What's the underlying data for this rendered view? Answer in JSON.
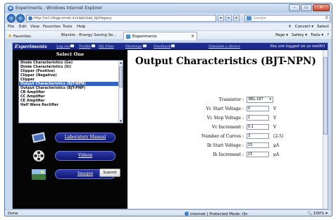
{
  "window": {
    "title": "Experiments - Windows Internet Explorer",
    "buttons": {
      "minimize": "–",
      "maximize": "▭",
      "close": "✕"
    }
  },
  "address_bar": {
    "url": "http://vcl.iitkgp.ernet.in/vlab/vlab_bjt/legacy",
    "search_placeholder": "Google",
    "tools": [
      "▾",
      "✕",
      "⟳"
    ]
  },
  "menu": {
    "items": [
      "File",
      "Edit",
      "View",
      "Favorites",
      "Tools",
      "Help"
    ],
    "right": [
      "✕",
      "Convert ▾",
      "Select"
    ]
  },
  "favorites_bar": {
    "favorites_label": "Favorites",
    "items": [
      "Blackle - Energy Saving Se..."
    ],
    "active_tab": "Experiments",
    "commands": [
      "Page ▾",
      "Safety ▾",
      "Tools ▾",
      "?"
    ]
  },
  "site_nav": {
    "brand": "Experiments",
    "links": [
      "Log out",
      "Profile",
      "My Files",
      "Meetings",
      "Feedback",
      "Simulate a device"
    ],
    "logged_in_text": "You are logged on as  me001"
  },
  "left_panel": {
    "heading": "Select One",
    "options": [
      "Diode Characteristics (Ge)",
      "Diode Characteristics (Si)",
      "Clipper (Positive)",
      "Clipper (Negative)",
      "Clipper",
      "Output Characteristics (BJT-NPN)",
      "Output Characteristics (BJT-PNP)",
      "CB Amplifier",
      "CC Amplifier",
      "CE Amplifier",
      "Half Wave Rectifier"
    ],
    "selected_index": 5,
    "links": [
      "Laboratory Manual",
      "Videos",
      "Images"
    ]
  },
  "main": {
    "title": "Output Characteristics (BJT-NPN)",
    "form": [
      {
        "label": "Transistor :",
        "type": "select",
        "value": "BEL-187",
        "unit": ""
      },
      {
        "label": "Vc Start Voltage :",
        "type": "input",
        "value": "0",
        "unit": "V"
      },
      {
        "label": "Vc Stop Voltage :",
        "type": "input",
        "value": "1",
        "unit": "V"
      },
      {
        "label": "Vc Increment :",
        "type": "input",
        "value": "0.1",
        "unit": "V"
      },
      {
        "label": "Number of Curves :",
        "type": "input",
        "value": "3",
        "unit": "(2-5)"
      },
      {
        "label": "Ib Start Voltage :",
        "type": "input",
        "value": "15",
        "unit": "μA"
      },
      {
        "label": "Ib Increment :",
        "type": "input",
        "value": "15",
        "unit": "μA"
      }
    ],
    "submit_label": "Submit"
  },
  "status_bar": {
    "left": "Done",
    "zone": "Internet | Protected Mode: On",
    "zoom": "100%"
  }
}
